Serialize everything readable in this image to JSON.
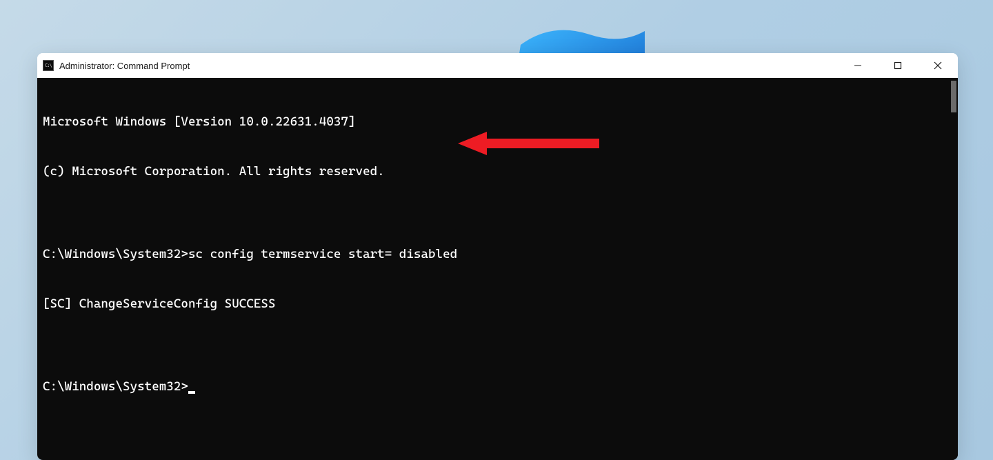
{
  "window": {
    "title": "Administrator: Command Prompt",
    "icon_label": "C:\\"
  },
  "terminal": {
    "lines": [
      "Microsoft Windows [Version 10.0.22631.4037]",
      "(c) Microsoft Corporation. All rights reserved.",
      "",
      "C:\\Windows\\System32>sc config termservice start= disabled",
      "[SC] ChangeServiceConfig SUCCESS",
      ""
    ],
    "prompt": "C:\\Windows\\System32>"
  },
  "controls": {
    "minimize": "Minimize",
    "maximize": "Maximize",
    "close": "Close"
  },
  "annotation": {
    "arrow_color": "#ed1c24"
  }
}
